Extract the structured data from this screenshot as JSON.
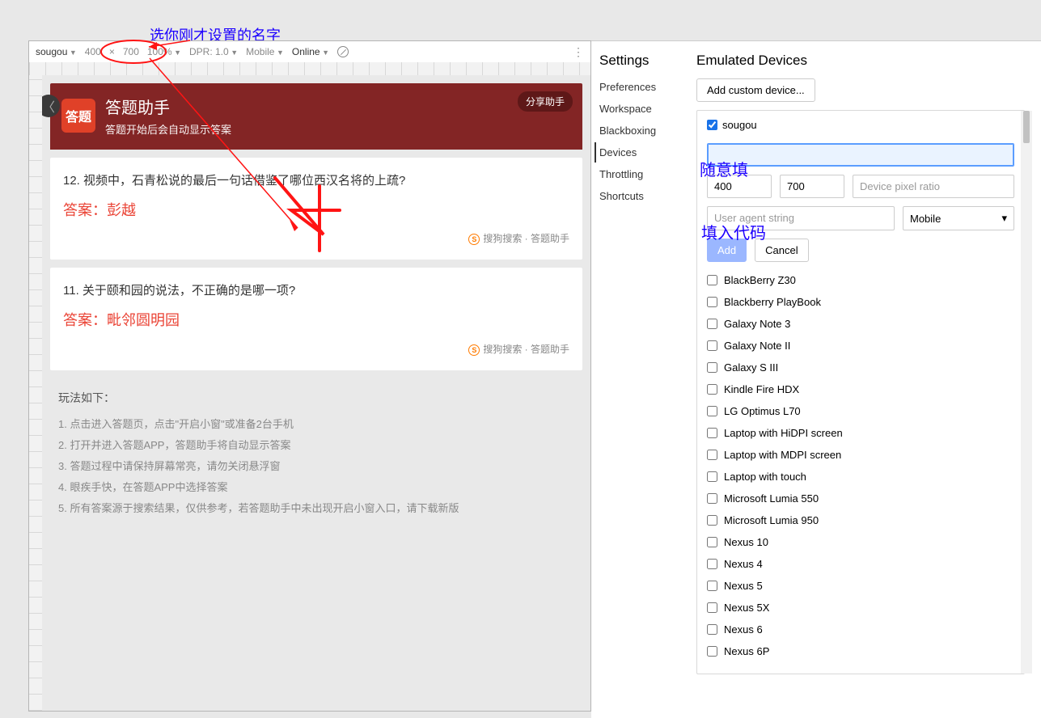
{
  "anno": {
    "top": "选你刚才设置的名字",
    "name": "随意填",
    "code": "填入代码"
  },
  "toolbar": {
    "device": "sougou",
    "w": "400",
    "x": "×",
    "h": "700",
    "zoom": "100%",
    "dpr": "DPR: 1.0",
    "type": "Mobile",
    "net": "Online"
  },
  "app": {
    "icon": "答题",
    "title": "答题助手",
    "sub": "答题开始后会自动显示答案",
    "share": "分享助手",
    "source": "搜狗搜索 · 答题助手",
    "q12": "12. 视频中，石青松说的最后一句话借鉴了哪位西汉名将的上疏?",
    "a12": "答案：彭越",
    "q11": "11. 关于颐和园的说法，不正确的是哪一项?",
    "a11": "答案：毗邻圆明园"
  },
  "inst": {
    "title": "玩法如下：",
    "i1": "1. 点击进入答题页，点击\"开启小窗\"或准备2台手机",
    "i2": "2. 打开并进入答题APP，答题助手将自动显示答案",
    "i3": "3. 答题过程中请保持屏幕常亮，请勿关闭悬浮窗",
    "i4": "4. 眼疾手快，在答题APP中选择答案",
    "i5": "5. 所有答案源于搜索结果，仅供参考，若答题助手中未出现开启小窗入口，请下载新版"
  },
  "settings": {
    "title": "Settings",
    "items": [
      "Preferences",
      "Workspace",
      "Blackboxing",
      "Devices",
      "Throttling",
      "Shortcuts"
    ],
    "active": "Devices"
  },
  "devices": {
    "title": "Emulated Devices",
    "add": "Add custom device...",
    "first": "sougou",
    "name_val": "",
    "w": "400",
    "h": "700",
    "dpr_ph": "Device pixel ratio",
    "ua_ph": "User agent string",
    "type": "Mobile",
    "addbtn": "Add",
    "cancel": "Cancel",
    "list": [
      "BlackBerry Z30",
      "Blackberry PlayBook",
      "Galaxy Note 3",
      "Galaxy Note II",
      "Galaxy S III",
      "Kindle Fire HDX",
      "LG Optimus L70",
      "Laptop with HiDPI screen",
      "Laptop with MDPI screen",
      "Laptop with touch",
      "Microsoft Lumia 550",
      "Microsoft Lumia 950",
      "Nexus 10",
      "Nexus 4",
      "Nexus 5",
      "Nexus 5X",
      "Nexus 6",
      "Nexus 6P"
    ]
  }
}
